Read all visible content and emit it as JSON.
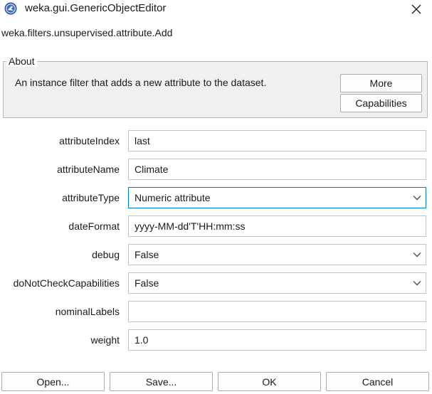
{
  "window": {
    "title": "weka.gui.GenericObjectEditor"
  },
  "class_name": "weka.filters.unsupervised.attribute.Add",
  "about": {
    "group_title": "About",
    "description": "An instance filter that adds a new attribute to the dataset.",
    "more_label": "More",
    "capabilities_label": "Capabilities"
  },
  "properties": {
    "attributeIndex": {
      "label": "attributeIndex",
      "value": "last"
    },
    "attributeName": {
      "label": "attributeName",
      "value": "Climate"
    },
    "attributeType": {
      "label": "attributeType",
      "value": "Numeric attribute"
    },
    "dateFormat": {
      "label": "dateFormat",
      "value": "yyyy-MM-dd'T'HH:mm:ss"
    },
    "debug": {
      "label": "debug",
      "value": "False"
    },
    "doNotCheckCapabilities": {
      "label": "doNotCheckCapabilities",
      "value": "False"
    },
    "nominalLabels": {
      "label": "nominalLabels",
      "value": ""
    },
    "weight": {
      "label": "weight",
      "value": "1.0"
    }
  },
  "buttons": {
    "open": "Open...",
    "save": "Save...",
    "ok": "OK",
    "cancel": "Cancel"
  },
  "icons": {
    "app": "weka-bird-icon",
    "close": "close-icon",
    "dropdown": "chevron-down-icon"
  },
  "colors": {
    "focus_border": "#0078d4",
    "about_background": "#f0f0f0"
  }
}
